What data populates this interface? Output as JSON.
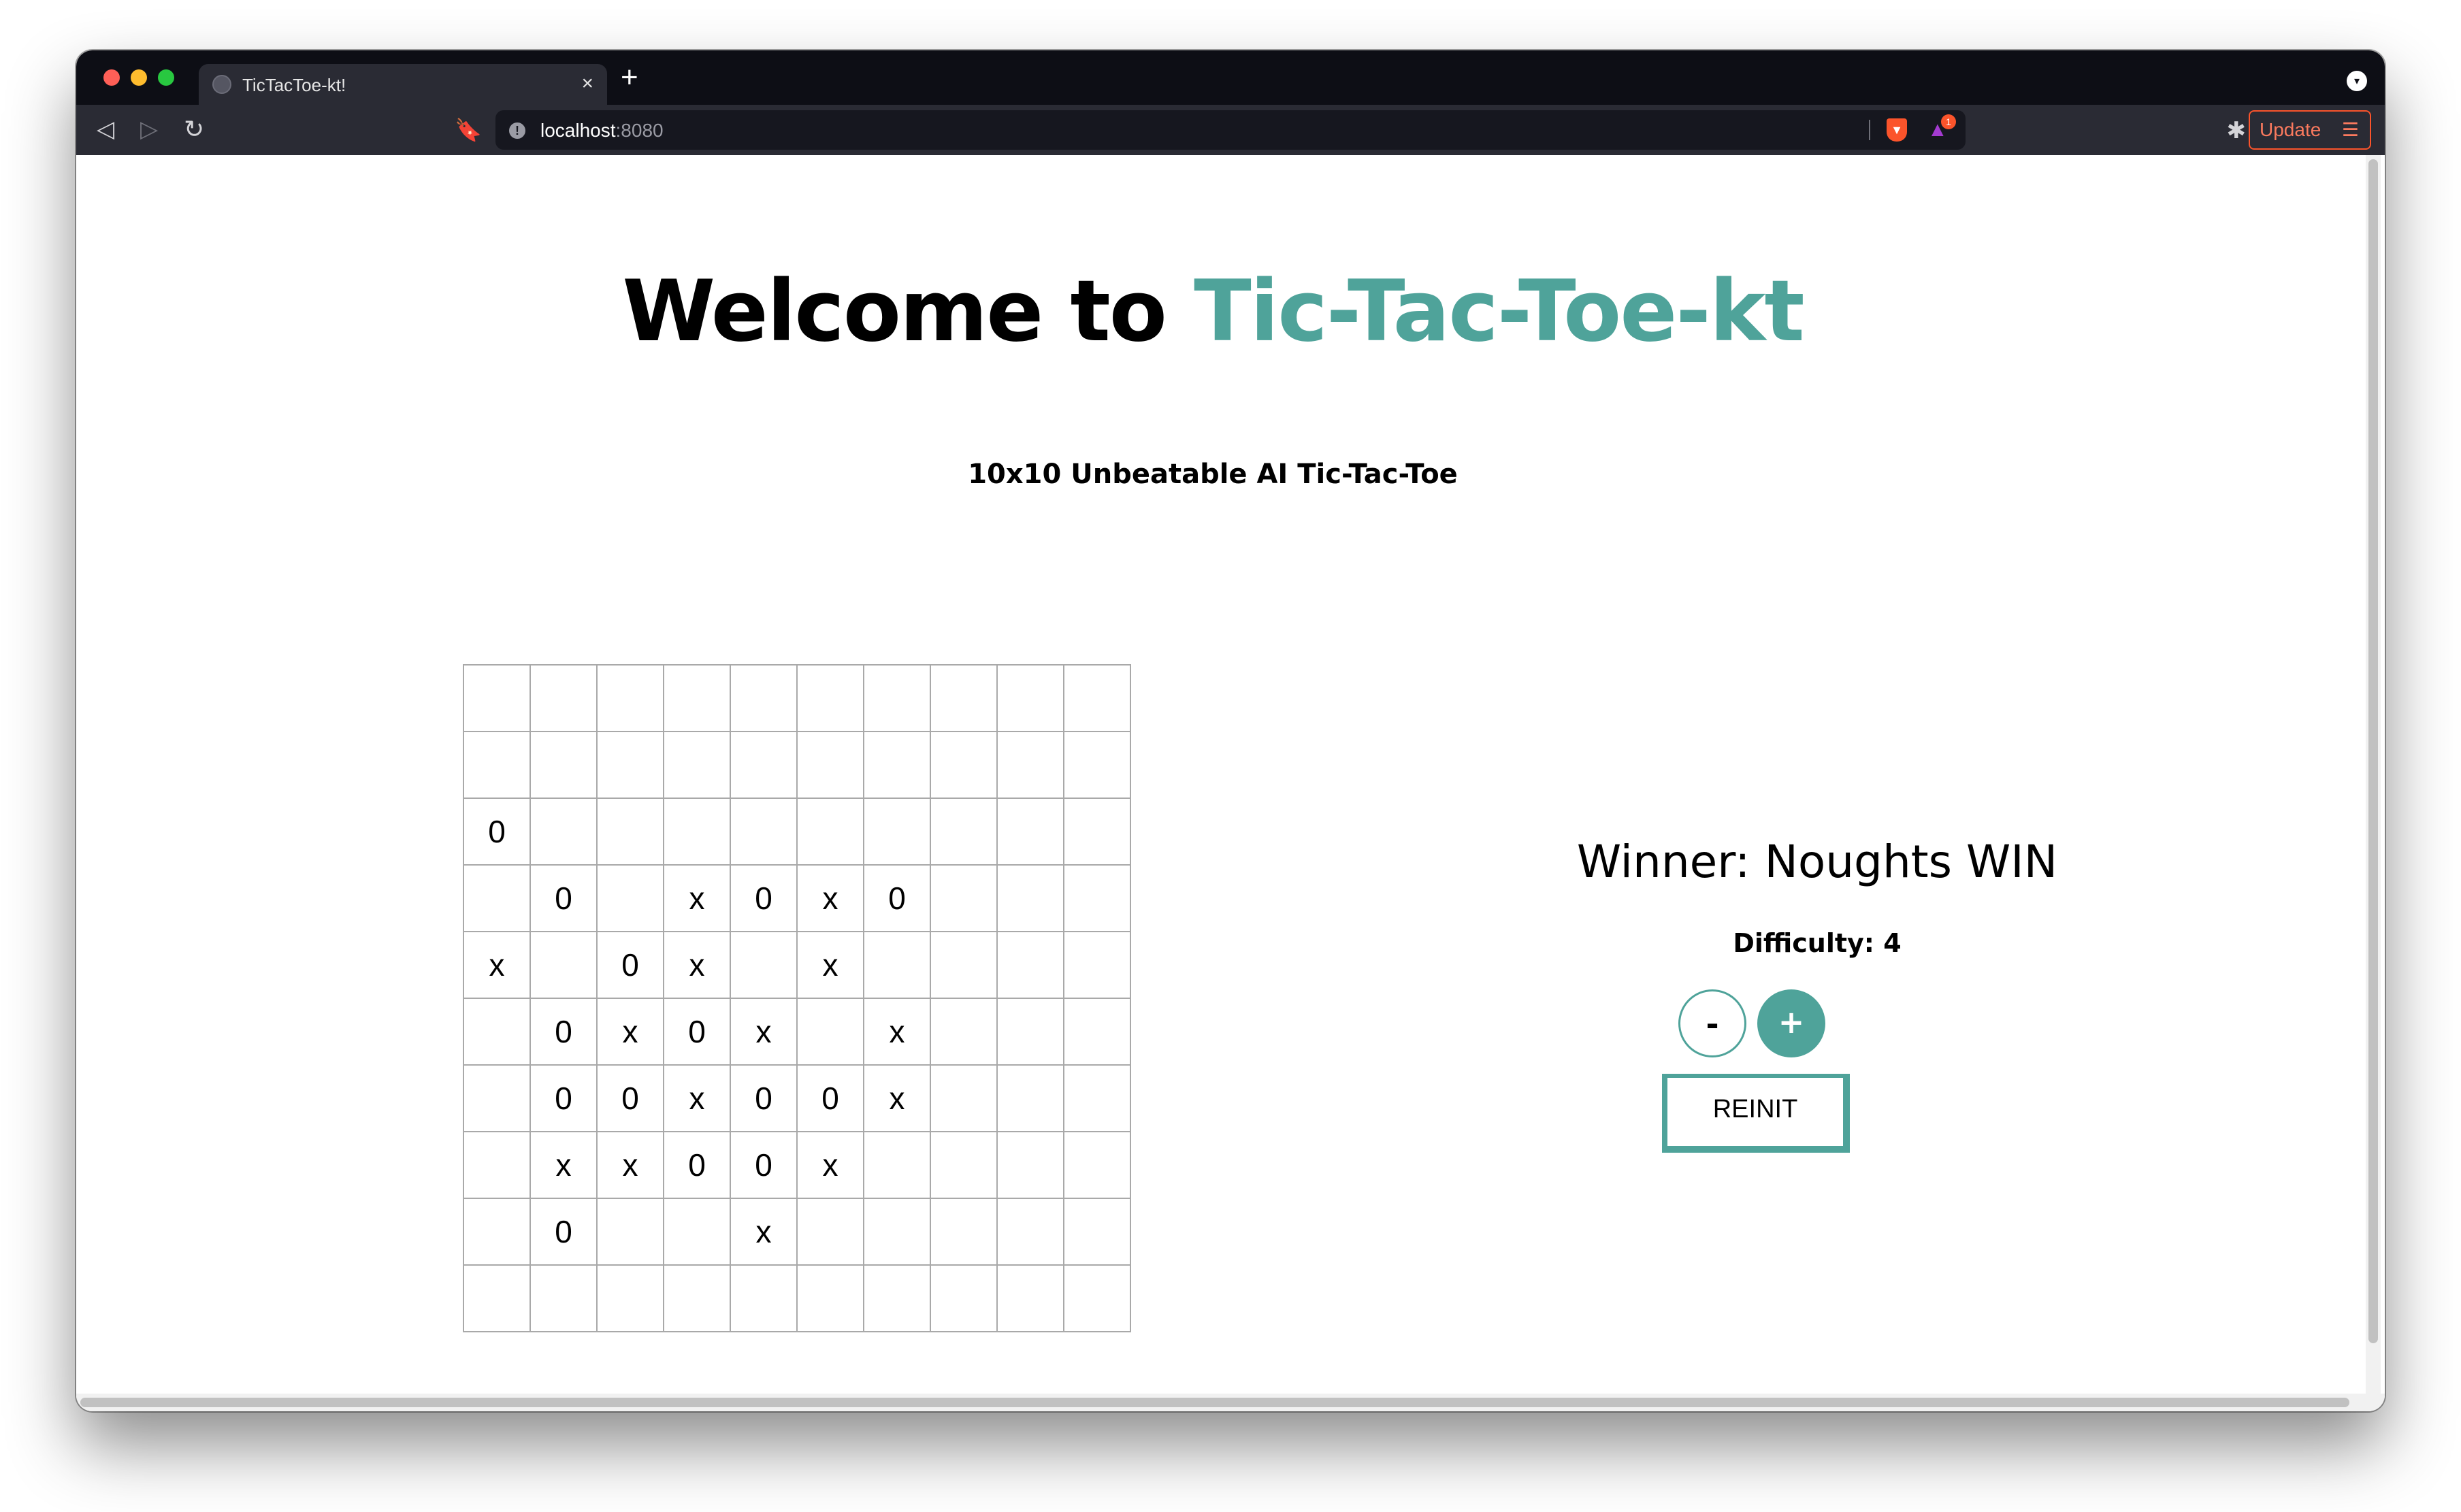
{
  "browser": {
    "tab_title": "TicTacToe-kt!",
    "tab_close_glyph": "×",
    "new_tab_glyph": "+",
    "url_host": "localhost",
    "url_port": ":8080",
    "update_label": "Update",
    "reward_badge": "1",
    "icons": [
      "back-icon",
      "forward-icon",
      "reload-icon",
      "bookmark-icon",
      "site-info-icon",
      "brave-shield-icon",
      "brave-rewards-icon",
      "extensions-icon",
      "menu-icon",
      "profile-icon"
    ],
    "colors": {
      "titlebar": "#0d0e15",
      "toolbar": "#2a2b34",
      "brave_orange": "#fb542b"
    }
  },
  "page": {
    "headline_prefix": "Welcome to ",
    "headline_brand": "Tic-Tac-Toe-kt",
    "subtitle": "10x10 Unbeatable AI Tic-Tac-Toe",
    "status": "Winner: Noughts WIN",
    "difficulty_label": "Difficulty: 4",
    "minus_label": "-",
    "plus_label": "+",
    "reinit_label": "REINIT",
    "accent_color": "#4fa39a"
  },
  "board": {
    "size": 10,
    "cells": [
      [
        "",
        "",
        "",
        "",
        "",
        "",
        "",
        "",
        "",
        ""
      ],
      [
        "",
        "",
        "",
        "",
        "",
        "",
        "",
        "",
        "",
        ""
      ],
      [
        "0",
        "",
        "",
        "",
        "",
        "",
        "",
        "",
        "",
        ""
      ],
      [
        "",
        "0",
        "",
        "x",
        "0",
        "x",
        "0",
        "",
        "",
        ""
      ],
      [
        "x",
        "",
        "0",
        "x",
        "",
        "x",
        "",
        "",
        "",
        ""
      ],
      [
        "",
        "0",
        "x",
        "0",
        "x",
        "",
        "x",
        "",
        "",
        ""
      ],
      [
        "",
        "0",
        "0",
        "x",
        "0",
        "0",
        "x",
        "",
        "",
        ""
      ],
      [
        "",
        "x",
        "x",
        "0",
        "0",
        "x",
        "",
        "",
        "",
        ""
      ],
      [
        "",
        "0",
        "",
        "",
        "x",
        "",
        "",
        "",
        "",
        ""
      ],
      [
        "",
        "",
        "",
        "",
        "",
        "",
        "",
        "",
        "",
        ""
      ]
    ]
  }
}
